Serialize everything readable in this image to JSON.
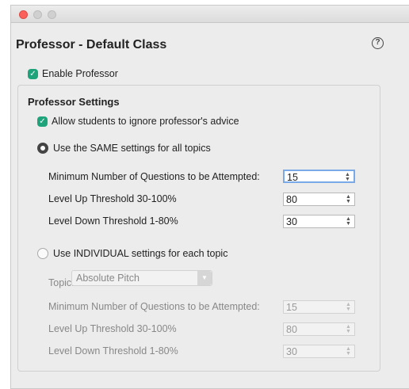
{
  "title": "Professor - Default Class",
  "help_glyph": "?",
  "enable_professor": {
    "label": "Enable Professor",
    "checked": true
  },
  "settings": {
    "title": "Professor Settings",
    "allow_ignore": {
      "label": "Allow students to ignore professor's advice",
      "checked": true
    },
    "same_option": {
      "label": "Use the SAME settings for all topics",
      "selected": true,
      "fields": [
        {
          "label": "Minimum Number of Questions to be Attempted:",
          "value": "15"
        },
        {
          "label": "Level Up Threshold 30-100%",
          "value": "80"
        },
        {
          "label": "Level Down Threshold 1-80%",
          "value": "30"
        }
      ]
    },
    "individual_option": {
      "label": "Use INDIVIDUAL settings for each topic",
      "selected": false,
      "topic_label": "Topic:",
      "topic_value": "Absolute Pitch",
      "fields": [
        {
          "label": "Minimum Number of Questions to be Attempted:",
          "value": "15"
        },
        {
          "label": "Level Up Threshold 30-100%",
          "value": "80"
        },
        {
          "label": "Level Down Threshold 1-80%",
          "value": "30"
        }
      ]
    }
  },
  "colors": {
    "checkbox": "#1fa37a",
    "focus_ring": "#7aa9e8"
  }
}
